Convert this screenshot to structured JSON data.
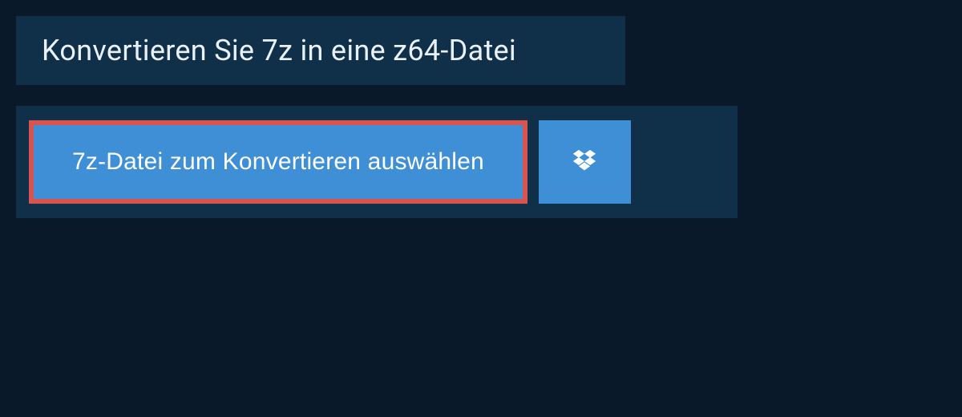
{
  "header": {
    "title": "Konvertieren Sie 7z in eine z64-Datei"
  },
  "actions": {
    "select_file_label": "7z-Datei zum Konvertieren auswählen",
    "dropbox_icon": "dropbox"
  },
  "colors": {
    "page_bg": "#0a1929",
    "panel_bg": "#10304a",
    "button_bg": "#3f8fd6",
    "highlight_border": "#d9544f",
    "text_light": "#eaf1f6",
    "text_button": "#ffffff"
  }
}
